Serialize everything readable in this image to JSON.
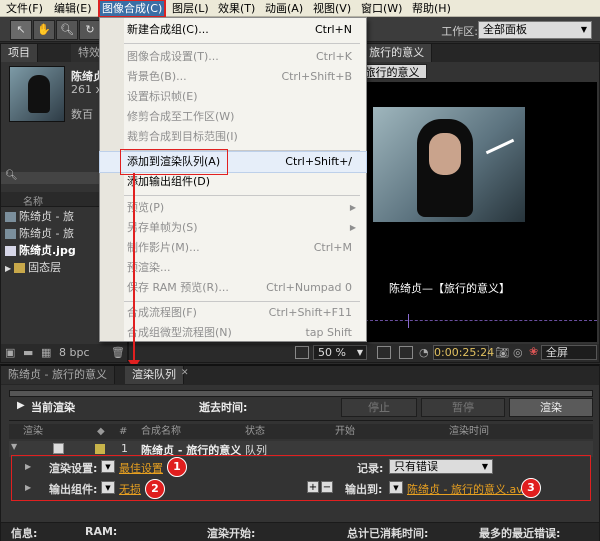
{
  "menubar": [
    "文件(F)",
    "编辑(E)",
    "图像合成(C)",
    "图层(L)",
    "效果(T)",
    "动画(A)",
    "视图(V)",
    "窗口(W)",
    "帮助(H)"
  ],
  "toolbar": {
    "workspace_label": "工作区:",
    "workspace_value": "全部面板"
  },
  "project_panel": {
    "tab_project": "项目",
    "tab_other": "特效",
    "preview_name": "陈绮贞",
    "preview_dims": "261 x",
    "preview_extra": "数百",
    "col_name": "名称",
    "items": [
      {
        "label": "陈绮贞 - 旅"
      },
      {
        "label": "陈绮贞 - 旅"
      },
      {
        "label": "陈绮贞.jpg"
      },
      {
        "label": "固态层"
      }
    ],
    "bpc": "8 bpc"
  },
  "comp_panel": {
    "tab": "合成: 陈绮贞 - 旅行的意义",
    "subtab": "旅行的意义",
    "caption": "陈绮贞—【旅行的意义】",
    "zoom": "50 %",
    "timecode": "0:00:25:24",
    "view": "全屏"
  },
  "dropdown": {
    "items": [
      {
        "label": "新建合成组(C)...",
        "shortcut": "Ctrl+N",
        "disabled": false
      },
      {
        "label": "图像合成设置(T)...",
        "shortcut": "Ctrl+K",
        "disabled": true
      },
      {
        "label": "背景色(B)...",
        "shortcut": "Ctrl+Shift+B",
        "disabled": true
      },
      {
        "label": "设置标识帧(E)",
        "shortcut": "",
        "disabled": true
      },
      {
        "label": "修剪合成至工作区(W)",
        "shortcut": "",
        "disabled": true
      },
      {
        "label": "裁剪合成到目标范围(I)",
        "shortcut": "",
        "disabled": true
      },
      {
        "label": "添加到渲染队列(A)",
        "shortcut": "Ctrl+Shift+/",
        "disabled": false
      },
      {
        "label": "添加输出组件(D)",
        "shortcut": "",
        "disabled": false
      },
      {
        "label": "预览(P)",
        "shortcut": "",
        "disabled": true
      },
      {
        "label": "另存单帧为(S)",
        "shortcut": "",
        "disabled": true
      },
      {
        "label": "制作影片(M)...",
        "shortcut": "Ctrl+M",
        "disabled": true
      },
      {
        "label": "预渲染...",
        "shortcut": "",
        "disabled": true
      },
      {
        "label": "保存 RAM 预览(R)...",
        "shortcut": "Ctrl+Numpad 0",
        "disabled": true
      },
      {
        "label": "合成流程图(F)",
        "shortcut": "Ctrl+Shift+F11",
        "disabled": true
      },
      {
        "label": "合成组微型流程图(N)",
        "shortcut": "tap Shift",
        "disabled": true
      }
    ]
  },
  "render_queue": {
    "tab_comp": "陈绮贞 - 旅行的意义",
    "tab_rq": "渲染队列",
    "current_render": "当前渲染",
    "elapsed": "逝去时间:",
    "btn_stop": "停止",
    "btn_pause": "暂停",
    "btn_render": "渲染",
    "headers": [
      "渲染",
      "#",
      "合成名称",
      "状态",
      "开始",
      "渲染时间"
    ],
    "row": {
      "num": "1",
      "name": "陈绮贞 - 旅行的意义",
      "status": "队列"
    },
    "render_settings_label": "渲染设置:",
    "render_settings_value": "最佳设置",
    "log_label": "记录:",
    "log_value": "只有错误",
    "output_module_label": "输出组件:",
    "output_module_value": "无损",
    "output_to_label": "输出到:",
    "output_to_value": "陈绮贞 - 旅行的意义.avi",
    "status_info": "信息:",
    "status_ram": "RAM:",
    "status_render_start": "渲染开始:",
    "status_total": "总计已消耗时间:",
    "status_recent_error": "最多的最近错误:"
  },
  "annotations": [
    "1",
    "2",
    "3"
  ],
  "colors": {
    "highlight_red": "#e12020",
    "link_orange": "#e8a020",
    "menu_active": "#3a6ea5"
  }
}
